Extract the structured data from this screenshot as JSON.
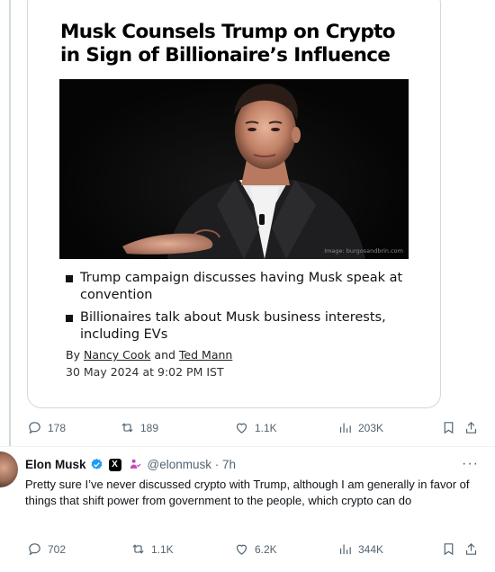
{
  "quoted_card": {
    "headline": "Musk Counsels Trump on Crypto in Sign of Billionaire’s Influence",
    "image_credit": "Image: burgosandbrin.com",
    "bullets": [
      "Trump campaign discusses having Musk speak at convention",
      "Billionaires talk about Musk business interests, including EVs"
    ],
    "byline_prefix": "By",
    "author_1": "Nancy Cook",
    "byline_and": "and",
    "author_2": "Ted Mann",
    "date": "30 May 2024 at 9:02 PM IST"
  },
  "first_tweet_actions": {
    "replies": "178",
    "reposts": "189",
    "likes": "1.1K",
    "views": "203K"
  },
  "reply_post": {
    "name": "Elon Musk",
    "x_badge": "X",
    "handle_time": "@elonmusk · 7h",
    "more": "···",
    "text": "Pretty sure I’ve never discussed crypto with Trump, although I am generally in favor of things that shift power from government to the people, which crypto can do",
    "actions": {
      "replies": "702",
      "reposts": "1.1K",
      "likes": "6.2K",
      "views": "344K"
    }
  },
  "colors": {
    "verified_blue": "#1d9bf0",
    "affiliate_pink": "#c04ab8",
    "muted_text": "#536471",
    "border": "#cfd9de"
  },
  "icons": [
    "reply-icon",
    "repost-icon",
    "like-icon",
    "views-icon",
    "bookmark-icon",
    "share-icon",
    "verified-icon",
    "x-badge-icon",
    "affiliate-icon",
    "more-icon"
  ]
}
